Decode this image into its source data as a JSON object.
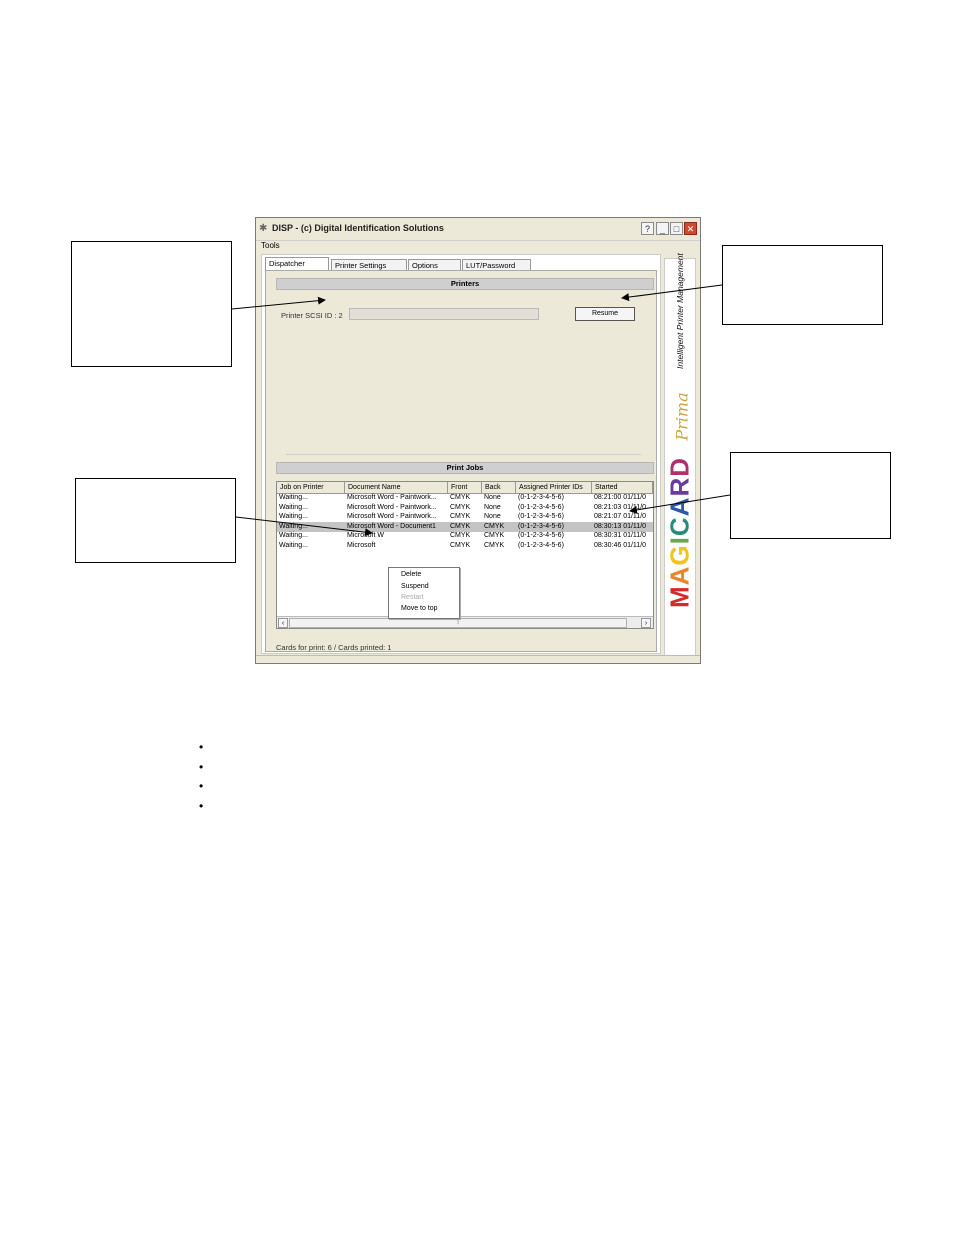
{
  "window": {
    "title": "DISP - (c) Digital Identification Solutions",
    "menu": [
      "Tools"
    ],
    "tabs": [
      "Dispatcher",
      "Printer Settings",
      "Options",
      "LUT/Password"
    ],
    "active_tab": "Dispatcher"
  },
  "printers": {
    "header": "Printers",
    "printer_label": "Printer SCSI ID : 2",
    "resume_button": "Resume"
  },
  "print_jobs": {
    "header": "Print Jobs",
    "columns": [
      "Job on Printer",
      "Document Name",
      "Front",
      "Back",
      "Assigned Printer IDs",
      "Started"
    ],
    "rows": [
      [
        "Waiting...",
        "Microsoft Word - Paintwork...",
        "CMYK",
        "None",
        "(0-1-2-3-4-5-6)",
        "08:21:00 01/11/0"
      ],
      [
        "Waiting...",
        "Microsoft Word - Paintwork...",
        "CMYK",
        "None",
        "(0-1-2-3-4-5-6)",
        "08:21:03 01/11/0"
      ],
      [
        "Waiting...",
        "Microsoft Word - Paintwork...",
        "CMYK",
        "None",
        "(0-1-2-3-4-5-6)",
        "08:21:07 01/11/0"
      ],
      [
        "Waiting...",
        "Microsoft Word - Document1",
        "CMYK",
        "CMYK",
        "(0-1-2-3-4-5-6)",
        "08:30:13 01/11/0"
      ],
      [
        "Waiting...",
        "Microsoft W",
        "CMYK",
        "CMYK",
        "(0-1-2-3-4-5-6)",
        "08:30:31 01/11/0"
      ],
      [
        "Waiting...",
        "Microsoft",
        "CMYK",
        "CMYK",
        "(0-1-2-3-4-5-6)",
        "08:30:46 01/11/0"
      ]
    ],
    "selected_row": 3,
    "context_menu": [
      "Delete",
      "Suspend",
      "Restart",
      "Move to top"
    ],
    "context_menu_disabled": [
      "Restart"
    ]
  },
  "status": {
    "cards_text": "Cards for print: 6 / Cards printed: 1"
  },
  "banner": {
    "tagline": "Intelligent Printer Management",
    "sub": "Prima",
    "letters": [
      "M",
      "A",
      "G",
      "I",
      "C",
      "A",
      "R",
      "D"
    ],
    "letter_colors": [
      "#d62a2a",
      "#e8872a",
      "#f0c419",
      "#6aa84f",
      "#2a8a7a",
      "#2a5aa8",
      "#6a3aa0",
      "#b0306a"
    ]
  },
  "bullet_count": 4
}
